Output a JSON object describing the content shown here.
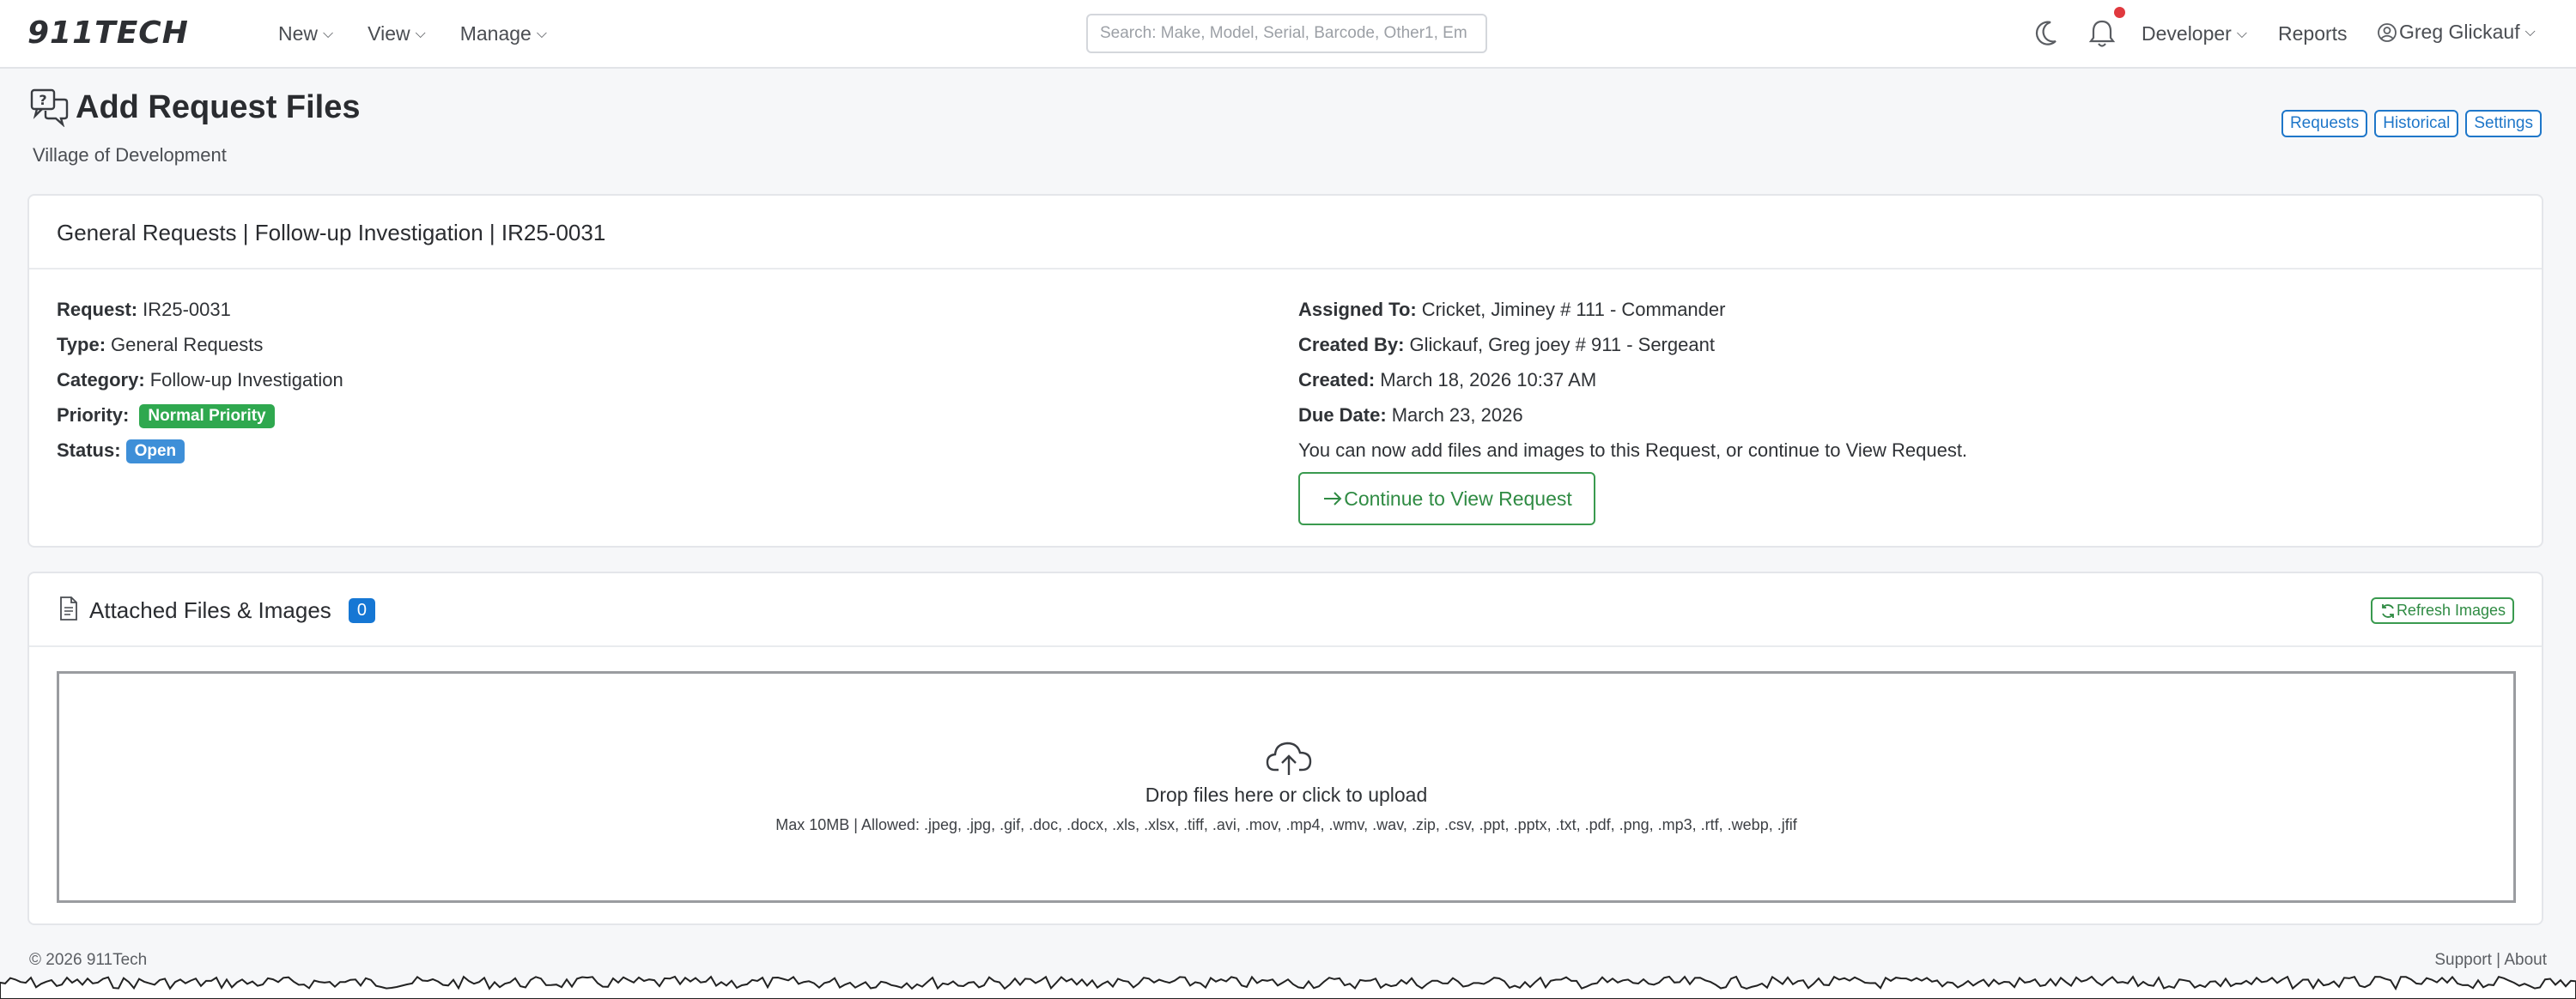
{
  "nav": {
    "logo": "911TECH",
    "menu": [
      "New",
      "View",
      "Manage"
    ],
    "search_placeholder": "Search: Make, Model, Serial, Barcode, Other1, Em",
    "developer": "Developer",
    "reports": "Reports",
    "user": "Greg Glickauf"
  },
  "page": {
    "title": "Add Request Files",
    "subtitle": "Village of Development",
    "buttons": [
      "Requests",
      "Historical",
      "Settings"
    ]
  },
  "request_card": {
    "title": "General Requests | Follow-up Investigation | IR25-0031",
    "left": {
      "request_label": "Request:",
      "request_value": "IR25-0031",
      "type_label": "Type:",
      "type_value": "General Requests",
      "category_label": "Category:",
      "category_value": "Follow-up Investigation",
      "priority_label": "Priority:",
      "priority_value": "Normal Priority",
      "status_label": "Status:",
      "status_value": "Open"
    },
    "right": {
      "assigned_label": "Assigned To:",
      "assigned_value": "Cricket, Jiminey # 111 - Commander",
      "created_by_label": "Created By:",
      "created_by_value": "Glickauf, Greg joey # 911 - Sergeant",
      "created_label": "Created:",
      "created_value": "March 18, 2026 10:37 AM",
      "due_label": "Due Date:",
      "due_value": "March 23, 2026",
      "note": "You can now add files and images to this Request, or continue to View Request.",
      "continue_label": "Continue to View Request"
    }
  },
  "files_card": {
    "title": "Attached Files & Images",
    "count": "0",
    "refresh_label": "Refresh Images",
    "drop_main": "Drop files here or click to upload",
    "drop_sub": "Max 10MB | Allowed: .jpeg, .jpg, .gif, .doc, .docx, .xls, .xlsx, .tiff, .avi, .mov, .mp4, .wmv, .wav, .zip, .csv, .ppt, .pptx, .txt, .pdf, .png, .mp3, .rtf, .webp, .jfif"
  },
  "footer": {
    "copyright": "© 2026 911Tech",
    "support": "Support",
    "sep": "|",
    "about": "About"
  },
  "colors": {
    "primary": "#1f77c9",
    "success": "#2fa84f",
    "status_open": "#3e8fd8",
    "notification_dot": "#e0393e"
  }
}
